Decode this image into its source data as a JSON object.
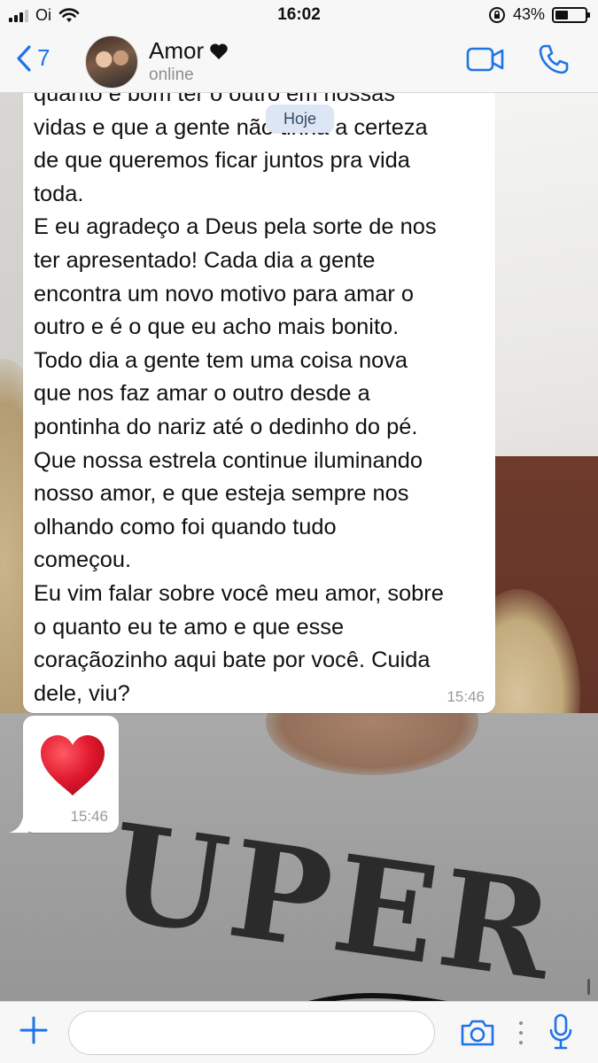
{
  "status_bar": {
    "carrier": "Oi",
    "time": "16:02",
    "battery_percent": "43%",
    "battery_level": 0.43
  },
  "header": {
    "back_count": "7",
    "contact_name": "Amor",
    "contact_status": "online"
  },
  "date_separator": "Hoje",
  "messages": [
    {
      "type": "text",
      "text": "quanto é bom ter o outro em nossas\nvidas e que a gente não tinha a certeza\nde que queremos ficar juntos pra vida\ntoda.\nE eu agradeço a Deus pela sorte de nos\nter apresentado! Cada dia a gente\nencontra um novo motivo para amar o\noutro e é o que eu acho mais bonito.\nTodo dia a gente tem uma coisa nova\nque nos faz amar o outro desde a\npontinha do nariz até o dedinho do pé.\nQue nossa estrela continue iluminando\nnosso amor, e que esteja sempre nos\nolhando como foi quando tudo\ncomeçou.\nEu vim falar sobre você meu amor, sobre\no quanto eu te amo e que esse\ncoraçãozinho aqui bate por você. Cuida\ndele, viu?",
      "time": "15:46"
    },
    {
      "type": "emoji",
      "emoji": "red-heart",
      "time": "15:46"
    }
  ],
  "input": {
    "placeholder": "",
    "value": ""
  },
  "wallpaper": {
    "shirt_print": "UPER"
  },
  "colors": {
    "accent": "#1e74e6",
    "bubble_in": "#ffffff",
    "date_pill": "#dce6f5",
    "heart": "#e0182d"
  }
}
